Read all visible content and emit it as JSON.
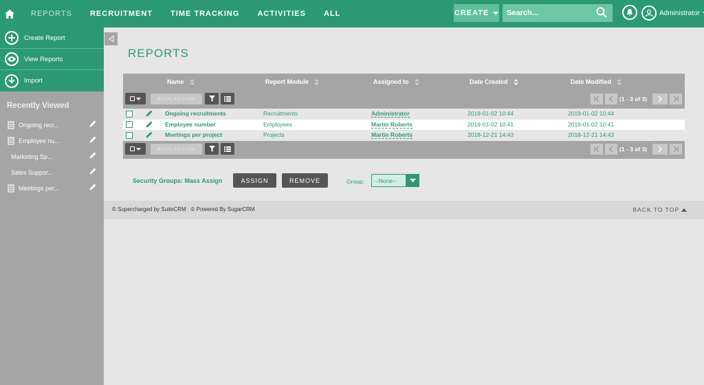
{
  "nav": {
    "tabs": [
      "REPORTS",
      "RECRUITMENT",
      "TIME TRACKING",
      "ACTIVITIES",
      "ALL"
    ],
    "create_label": "CREATE",
    "search_placeholder": "Search...",
    "user_name": "Administrator"
  },
  "sidebar": {
    "actions": [
      "Create Report",
      "View Reports",
      "Import"
    ],
    "recent_title": "Recently Viewed",
    "recent": [
      "Ongoing recr...",
      "Employee nu...",
      "Marketing Sp...",
      "Sales Suppor...",
      "Meetings per..."
    ]
  },
  "page": {
    "title": "REPORTS"
  },
  "table": {
    "headers": [
      "Name",
      "Report Module",
      "Assigned to",
      "Date Created",
      "Date Modified"
    ],
    "bulk_action": "BULK ACTION",
    "pagination": "(1 - 3 of 3)",
    "rows": [
      {
        "name": "Ongoing recruitments",
        "module": "Recruitments",
        "assigned": "Administrator",
        "created": "2019-01-02 10:44",
        "modified": "2019-01-02 10:44"
      },
      {
        "name": "Employee number",
        "module": "Employees",
        "assigned": "Martin Roberts",
        "created": "2019-01-02 10:41",
        "modified": "2019-01-02 10:41"
      },
      {
        "name": "Meetings per project",
        "module": "Projects",
        "assigned": "Martin Roberts",
        "created": "2018-12-21 14:43",
        "modified": "2018-12-21 14:43"
      }
    ]
  },
  "mass": {
    "label": "Security Groups: Mass Assign",
    "assign": "ASSIGN",
    "remove": "REMOVE",
    "group_label": "Group:",
    "group_value": "--None--"
  },
  "footer": {
    "left": "© Supercharged by SuiteCRM   © Powered By SugarCRM",
    "back_to_top": "BACK TO TOP"
  },
  "colors": {
    "accent": "#2b9a74",
    "sidebar": "#a5a5a5"
  }
}
